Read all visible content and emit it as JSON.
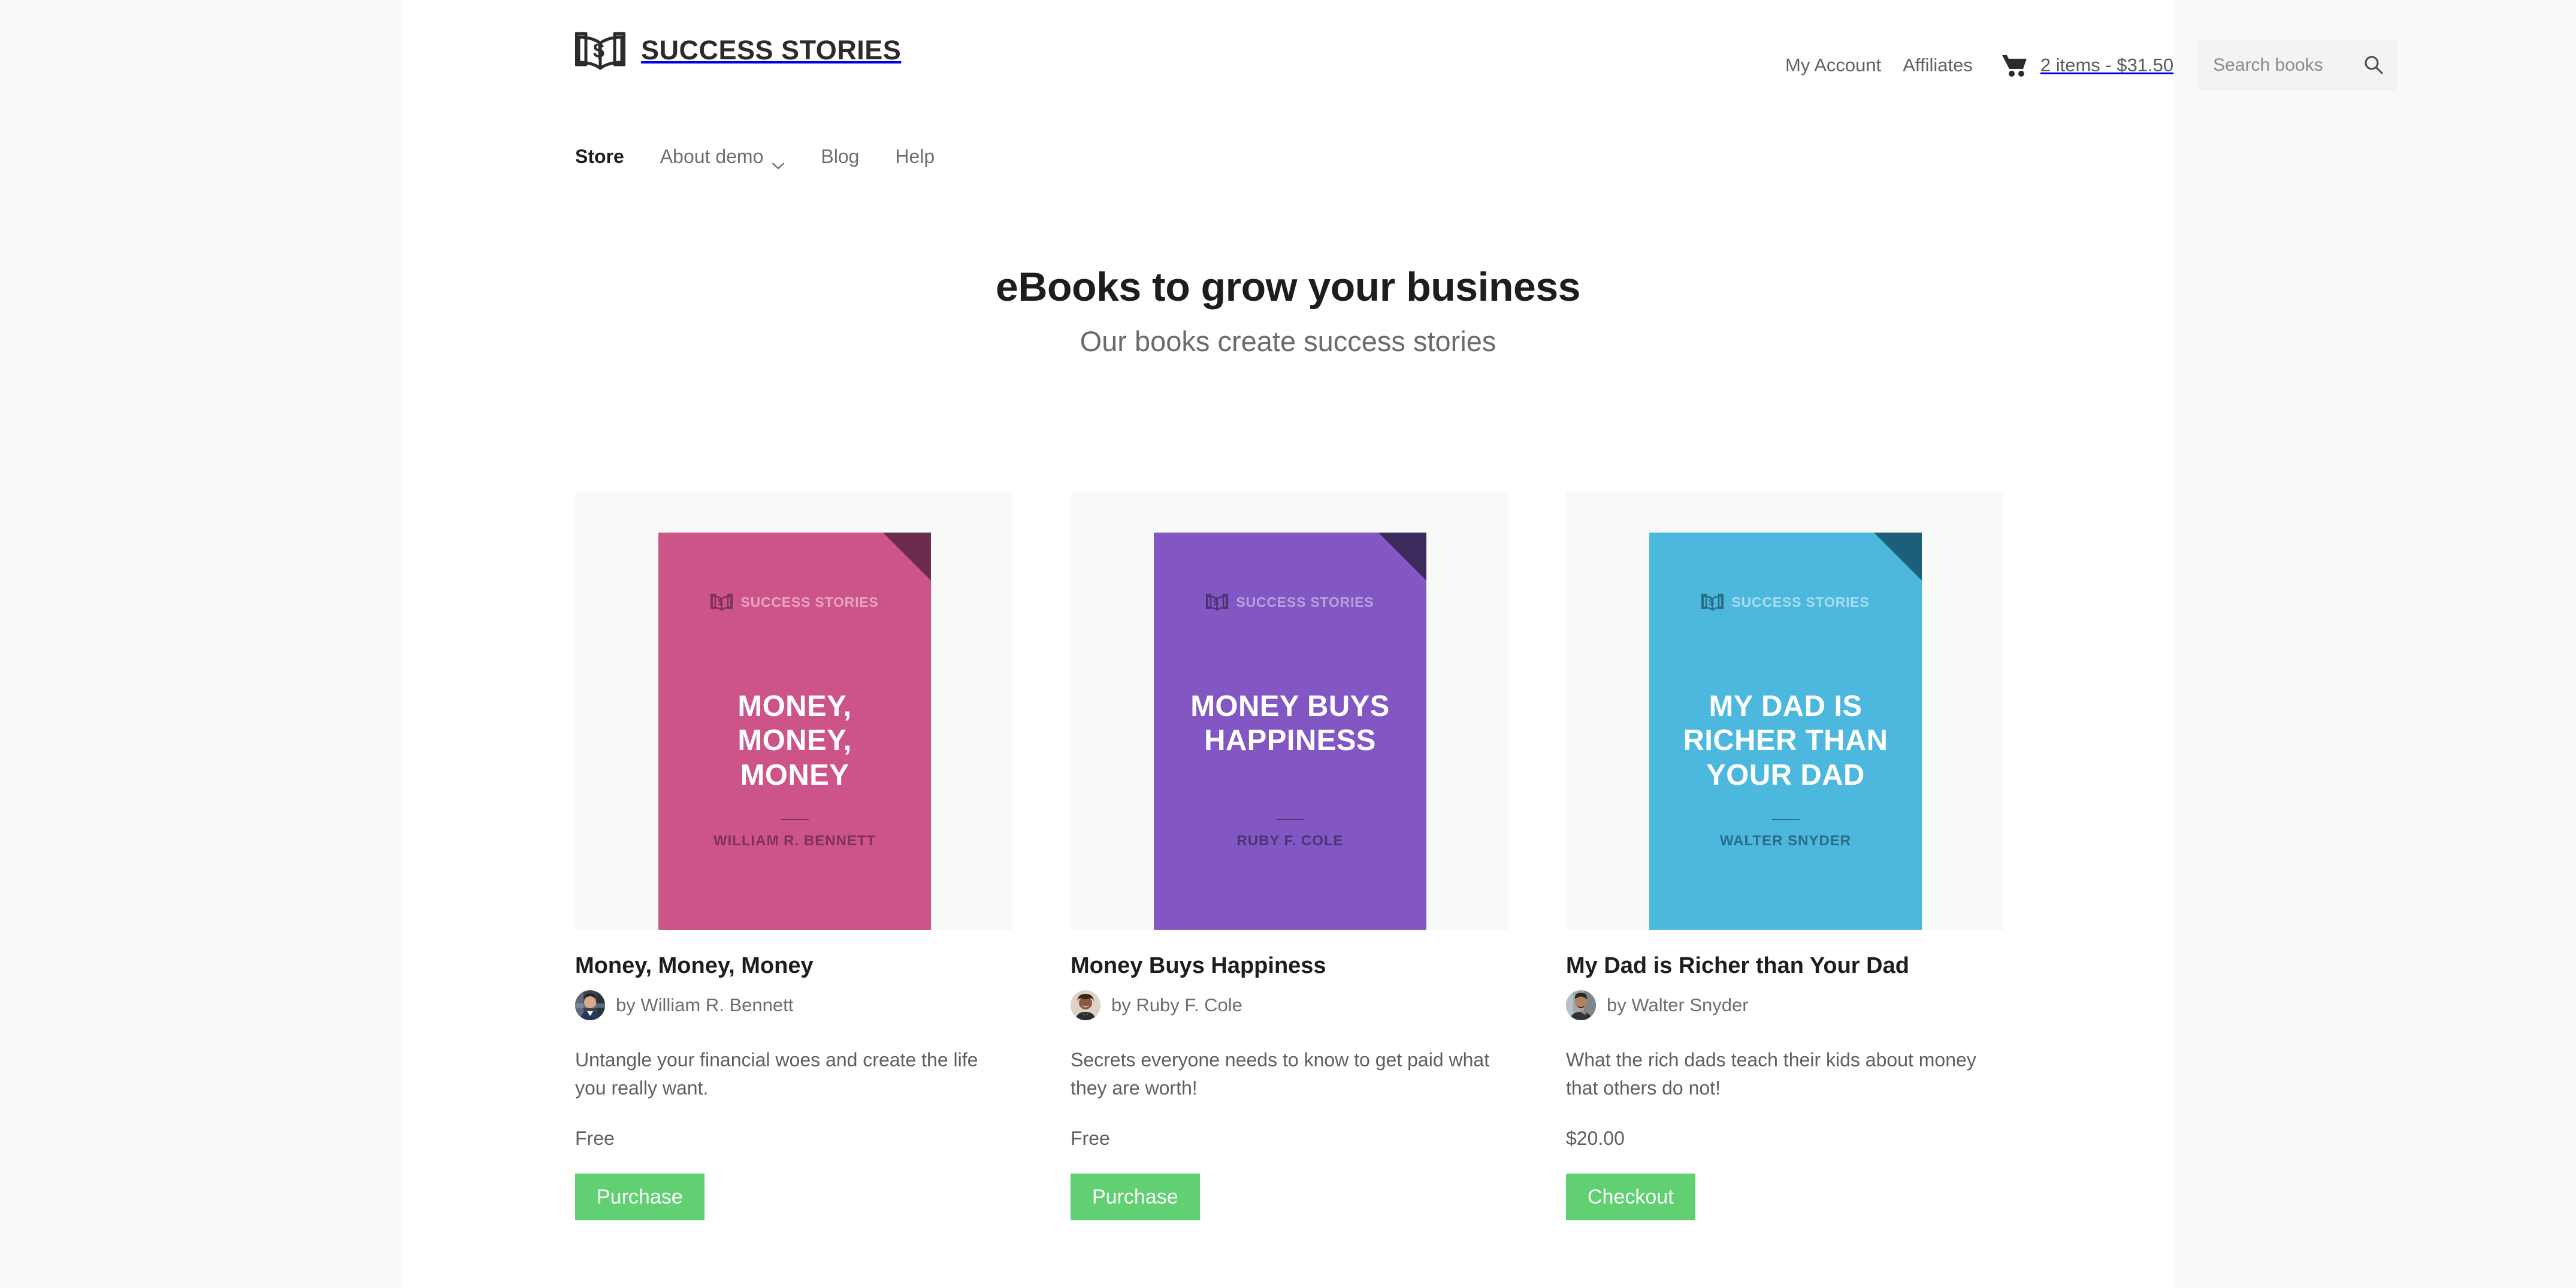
{
  "brand": {
    "name": "SUCCESS STORIES",
    "logo_icon": "open-book-dollar-logo",
    "logo_green": "#8cc152",
    "logo_dark": "#2b2b2b"
  },
  "header": {
    "links": [
      {
        "label": "My Account",
        "name": "my-account-link"
      },
      {
        "label": "Affiliates",
        "name": "affiliates-link"
      }
    ],
    "cart": {
      "icon": "shopping-cart-icon",
      "text": "2 items - $31.50",
      "items": 2,
      "total": "$31.50"
    },
    "search": {
      "placeholder": "Search books",
      "value": "",
      "icon": "search-icon"
    }
  },
  "mainnav": {
    "items": [
      {
        "label": "Store",
        "active": true
      },
      {
        "label": "About demo",
        "active": false,
        "icon": "chevron-down-icon"
      },
      {
        "label": "Blog",
        "active": false
      },
      {
        "label": "Help",
        "active": false
      }
    ]
  },
  "hero": {
    "title": "eBooks to grow your business",
    "subtitle": "Our books create success stories"
  },
  "books": [
    {
      "title": "Money, Money, Money",
      "byline": "by William R. Bennett",
      "author": "William R. Bennett",
      "description": "Untangle your financial woes and create the life you really want.",
      "price": "Free",
      "button": "Purchase",
      "cover": {
        "title_lines": [
          "MONEY,",
          "MONEY,",
          "MONEY"
        ],
        "author_caps": "WILLIAM R. BENNETT",
        "logo_text": "SUCCESS STORIES",
        "color": "#cd5489",
        "fold_color": "#6d2b4e",
        "logo_color": "#e8a5c3",
        "author_color": "#7d3258",
        "rule_color": "#a8graph"
      }
    },
    {
      "title": "Money Buys Happiness",
      "byline": "by Ruby F. Cole",
      "author": "Ruby F. Cole",
      "description": "Secrets everyone needs to know to get paid what they are worth!",
      "price": "Free",
      "button": "Purchase",
      "cover": {
        "title_lines": [
          "MONEY BUYS",
          "HAPPINESS"
        ],
        "author_caps": "RUBY F. COLE",
        "logo_text": "SUCCESS STORIES",
        "color": "#8257c4",
        "fold_color": "#3d2a5c",
        "logo_color": "#b9a2dd",
        "author_color": "#4b3473"
      }
    },
    {
      "title": "My Dad is Richer than Your Dad",
      "byline": "by Walter Snyder",
      "author": "Walter Snyder",
      "description": "What the rich dads teach their kids about money that others do not!",
      "price": "$20.00",
      "button": "Checkout",
      "cover": {
        "title_lines": [
          "MY DAD IS",
          "RICHER THAN",
          "YOUR DAD"
        ],
        "author_caps": "WALTER SNYDER",
        "logo_text": "SUCCESS STORIES",
        "color": "#4cb8de",
        "fold_color": "#1d5f78",
        "logo_color": "#a9dcee",
        "author_color": "#2c6b85"
      }
    }
  ],
  "colors": {
    "page_background": "#ffffff",
    "outer_background": "#f8faf7",
    "tile_background": "#f8faf7",
    "button_green": "#60d072",
    "search_background": "#f3f3f3"
  }
}
